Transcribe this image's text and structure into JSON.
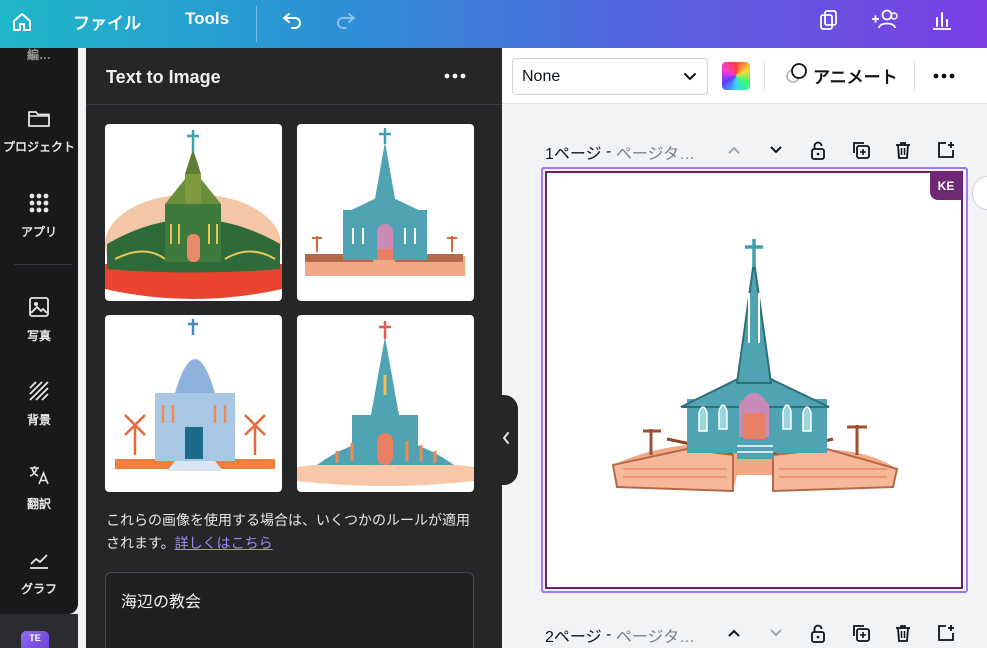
{
  "topbar": {
    "file_label": "ファイル",
    "tools_label": "Tools",
    "icons": [
      "home-icon",
      "undo-icon",
      "redo-icon",
      "pages-icon",
      "add-people-icon",
      "insights-icon"
    ]
  },
  "rail": {
    "top_partial_label": "編…",
    "items": [
      {
        "label": "プロジェクト",
        "icon": "folder-icon"
      },
      {
        "label": "アプリ",
        "icon": "apps-grid-icon"
      },
      {
        "label": "写真",
        "icon": "photo-icon"
      },
      {
        "label": "背景",
        "icon": "background-icon"
      },
      {
        "label": "翻訳",
        "icon": "translate-icon"
      },
      {
        "label": "グラフ",
        "icon": "chart-icon"
      }
    ],
    "badge_text": "TE"
  },
  "panel": {
    "title": "Text to Image",
    "note_text": "これらの画像を使用する場合は、いくつかのルールが適用されます。",
    "note_link": "詳しくはこちら",
    "prompt_value": "海辺の教会"
  },
  "editor": {
    "select_value": "None",
    "animate_label": "アニメート",
    "accent_color": "#9b7cf0"
  },
  "pages": [
    {
      "number_label": "1ページ",
      "separator": " - ",
      "title_placeholder": "ページタ…"
    },
    {
      "number_label": "2ページ",
      "separator": " - ",
      "title_placeholder": "ページタ…"
    }
  ],
  "collaborator_badge": "KE"
}
